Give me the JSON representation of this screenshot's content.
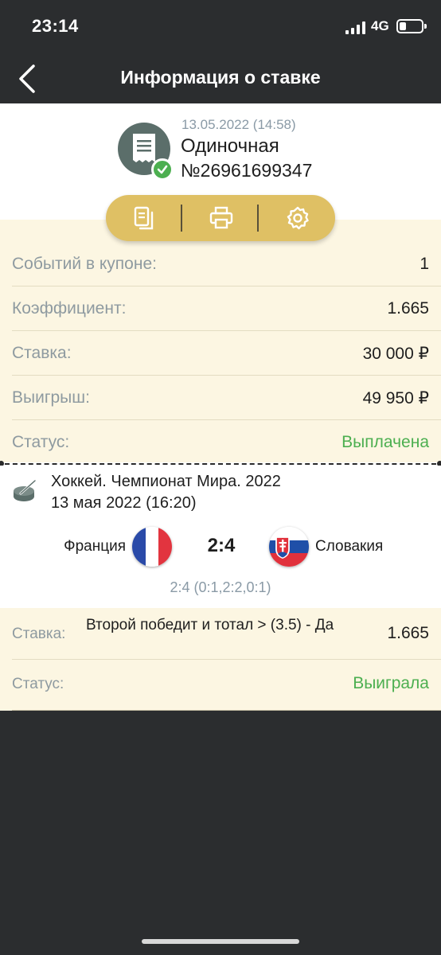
{
  "status_bar": {
    "time": "23:14",
    "network": "4G"
  },
  "nav": {
    "title": "Информация о ставке",
    "back_icon": "chevron-left-icon"
  },
  "bet": {
    "date": "13.05.2022 (14:58)",
    "type": "Одиночная",
    "number": "№26961699347"
  },
  "actions": [
    {
      "icon": "copy-icon"
    },
    {
      "icon": "printer-icon"
    },
    {
      "icon": "gear-icon"
    }
  ],
  "summary": [
    {
      "label": "Событий в купоне:",
      "value": "1"
    },
    {
      "label": "Коэффициент:",
      "value": "1.665"
    },
    {
      "label": "Ставка:",
      "value": "30 000 ₽"
    },
    {
      "label": "Выигрыш:",
      "value": "49 950 ₽"
    },
    {
      "label": "Статус:",
      "value": "Выплачена"
    }
  ],
  "event": {
    "league": "Хоккей. Чемпионат Мира. 2022",
    "date": "13 мая 2022 (16:20)",
    "team1": "Франция",
    "team2": "Словакия",
    "score": "2:4",
    "periods": "2:4 (0:1,2:2,0:1)"
  },
  "stake": {
    "label": "Ставка:",
    "description": "Второй победит и тотал > (3.5) - Да",
    "odds": "1.665",
    "status_label": "Статус:",
    "status_value": "Выиграла"
  },
  "colors": {
    "dark": "#2b2d2f",
    "cream": "#fcf6e2",
    "gold": "#dfc064",
    "green": "#4caf50",
    "muted": "#8e9aa0"
  }
}
